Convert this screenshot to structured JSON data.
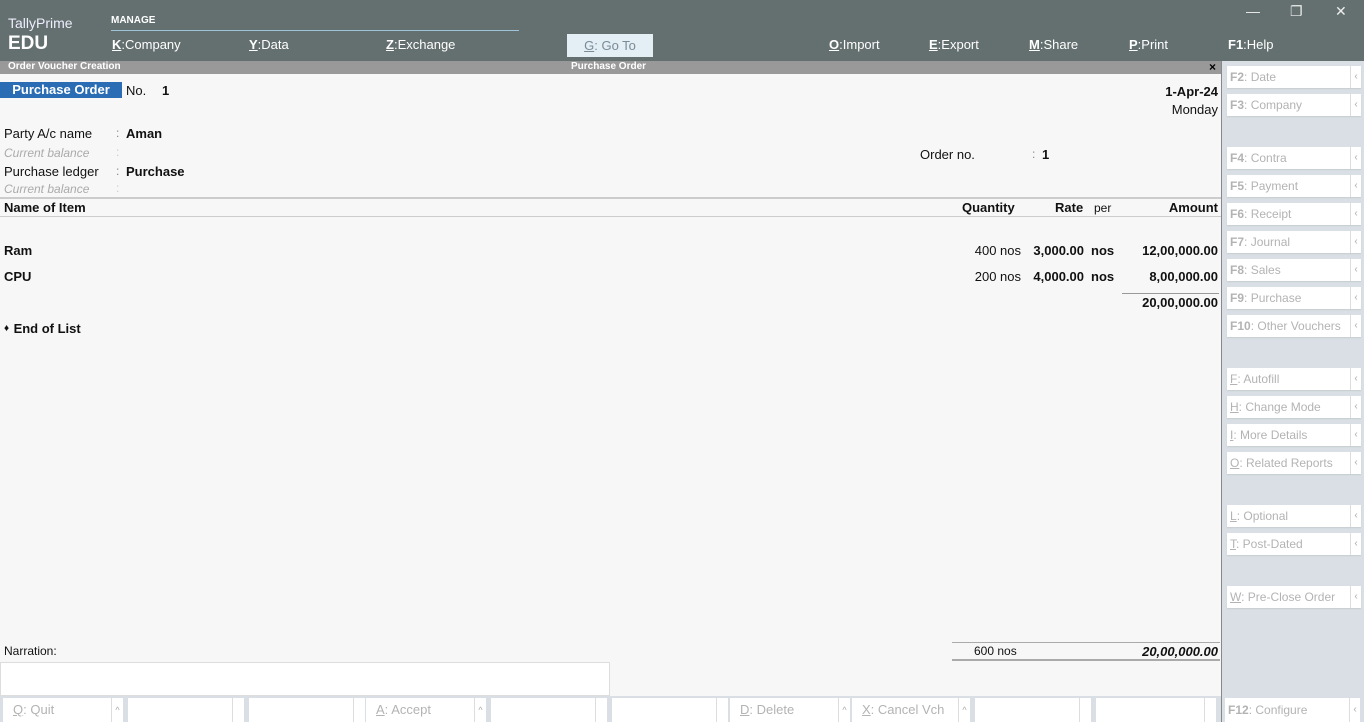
{
  "app": {
    "brand_line1": "TallyPrime",
    "brand_line2": "EDU",
    "section_label": "MANAGE",
    "window_controls": {
      "minimize": "—",
      "restore": "❐",
      "close": "✕"
    }
  },
  "top_menu": [
    {
      "key": "K",
      "label": "Company"
    },
    {
      "key": "Y",
      "label": "Data"
    },
    {
      "key": "Z",
      "label": "Exchange"
    },
    {
      "key": "O",
      "label": "Import"
    },
    {
      "key": "E",
      "label": "Export"
    },
    {
      "key": "M",
      "label": "Share"
    },
    {
      "key": "P",
      "label": "Print"
    },
    {
      "key": "F1",
      "label": "Help"
    }
  ],
  "goto": {
    "key": "G",
    "label": "Go To"
  },
  "title_strip": {
    "left": "Order Voucher Creation",
    "center": "Purchase Order",
    "close": "×"
  },
  "voucher": {
    "type": "Purchase Order",
    "no_label": "No.",
    "no_value": "1",
    "date": "1-Apr-24",
    "day": "Monday",
    "party_label": "Party A/c name",
    "party_value": "Aman",
    "current_balance_label": "Current balance",
    "purchase_ledger_label": "Purchase ledger",
    "purchase_ledger_value": "Purchase",
    "order_no_label": "Order no.",
    "order_no_value": "1",
    "colon": ":"
  },
  "table": {
    "headers": {
      "name": "Name of Item",
      "quantity": "Quantity",
      "rate": "Rate",
      "per": "per",
      "amount": "Amount"
    },
    "rows": [
      {
        "name": "Ram",
        "quantity": "400 nos",
        "rate": "3,000.00",
        "per": "nos",
        "amount": "12,00,000.00"
      },
      {
        "name": "CPU",
        "quantity": "200 nos",
        "rate": "4,000.00",
        "per": "nos",
        "amount": "8,00,000.00"
      }
    ],
    "subtotal": "20,00,000.00",
    "end_of_list": "End of List",
    "end_marker": "♦"
  },
  "totals": {
    "quantity": "600 nos",
    "amount": "20,00,000.00"
  },
  "narration": {
    "label": "Narration:",
    "value": ""
  },
  "right_panel": [
    {
      "key": "F2",
      "label": "Date"
    },
    {
      "key": "F3",
      "label": "Company"
    },
    {
      "key": "F4",
      "label": "Contra"
    },
    {
      "key": "F5",
      "label": "Payment"
    },
    {
      "key": "F6",
      "label": "Receipt"
    },
    {
      "key": "F7",
      "label": "Journal"
    },
    {
      "key": "F8",
      "label": "Sales"
    },
    {
      "key": "F9",
      "label": "Purchase"
    },
    {
      "key": "F10",
      "label": "Other Vouchers"
    },
    {
      "key": "F",
      "label": "Autofill"
    },
    {
      "key": "H",
      "label": "Change Mode"
    },
    {
      "key": "I",
      "label": "More Details"
    },
    {
      "key": "O",
      "label": "Related Reports"
    },
    {
      "key": "L",
      "label": "Optional"
    },
    {
      "key": "T",
      "label": "Post-Dated"
    },
    {
      "key": "W",
      "label": "Pre-Close Order"
    }
  ],
  "bottom_bar": [
    {
      "key": "Q",
      "label": "Quit"
    },
    {
      "key": "",
      "label": ""
    },
    {
      "key": "",
      "label": ""
    },
    {
      "key": "A",
      "label": "Accept"
    },
    {
      "key": "",
      "label": ""
    },
    {
      "key": "",
      "label": ""
    },
    {
      "key": "D",
      "label": "Delete"
    },
    {
      "key": "X",
      "label": "Cancel Vch"
    },
    {
      "key": "",
      "label": ""
    },
    {
      "key": "",
      "label": ""
    }
  ],
  "configure": {
    "key": "F12",
    "label": "Configure"
  },
  "arrow_left": "‹",
  "arrow_up": "^"
}
